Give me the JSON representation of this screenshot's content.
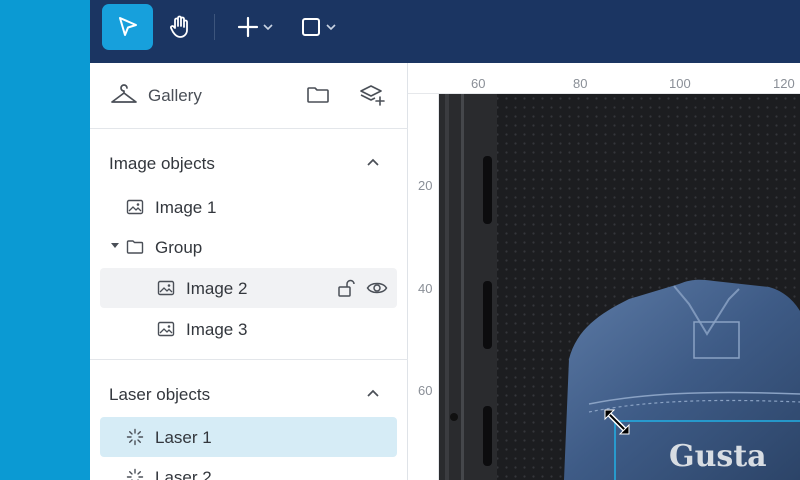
{
  "toolbar": {
    "tools": [
      {
        "name": "select",
        "icon": "cursor-arrow-icon",
        "active": true
      },
      {
        "name": "pan",
        "icon": "hand-icon",
        "active": false
      },
      {
        "name": "add",
        "icon": "plus-icon",
        "active": false
      },
      {
        "name": "shape",
        "icon": "square-icon",
        "active": false
      }
    ]
  },
  "panel": {
    "header": {
      "title": "Gallery",
      "icons": [
        "hanger-icon",
        "folder-icon",
        "add-layer-icon"
      ]
    },
    "image_section": {
      "title": "Image objects",
      "items": [
        {
          "label": "Image 1",
          "icon": "image-icon"
        },
        {
          "label": "Group",
          "icon": "folder-icon"
        },
        {
          "label": "Image 2",
          "icon": "image-icon"
        },
        {
          "label": "Image 3",
          "icon": "image-icon"
        }
      ]
    },
    "laser_section": {
      "title": "Laser objects",
      "items": [
        {
          "label": "Laser 1",
          "icon": "laser-burst-icon"
        },
        {
          "label": "Laser 2",
          "icon": "laser-burst-icon"
        }
      ]
    }
  },
  "canvas": {
    "ruler_top": [
      "60",
      "80",
      "100",
      "120"
    ],
    "ruler_left": [
      "20",
      "40",
      "60"
    ],
    "photo_text": "Gusta"
  },
  "colors": {
    "toolbar_bg": "#1b3562",
    "accent": "#17a0dc",
    "selected_row": "#d6ecf6",
    "left_strip": "#0b9ad3"
  }
}
